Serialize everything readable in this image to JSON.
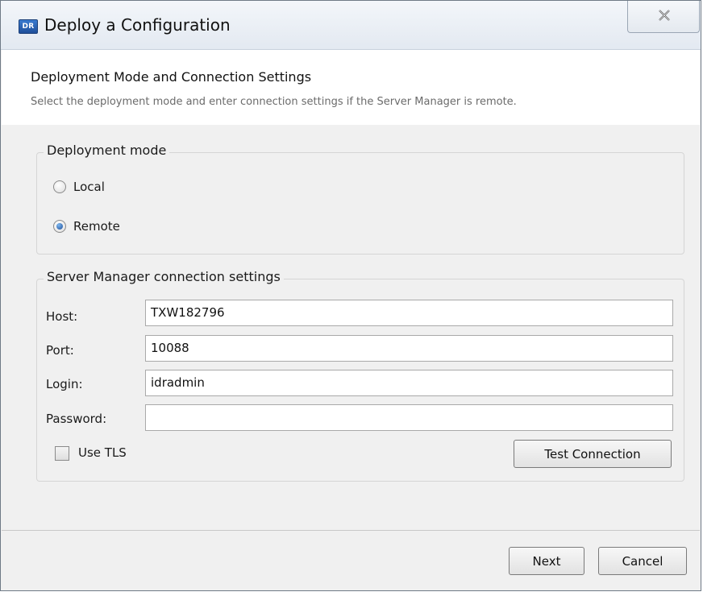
{
  "window": {
    "title": "Deploy a Configuration",
    "app_icon_text": "DR"
  },
  "header": {
    "title": "Deployment Mode and Connection Settings",
    "subtitle": "Select the deployment mode and enter connection settings if the Server Manager is remote."
  },
  "deployment_mode": {
    "legend": "Deployment mode",
    "options": [
      {
        "label": "Local",
        "checked": false
      },
      {
        "label": "Remote",
        "checked": true
      }
    ]
  },
  "connection": {
    "legend": "Server Manager connection settings",
    "host_label": "Host:",
    "host_value": "TXW182796",
    "port_label": "Port:",
    "port_value": "10088",
    "login_label": "Login:",
    "login_value": "idradmin",
    "password_label": "Password:",
    "password_value": "",
    "use_tls_label": "Use TLS",
    "use_tls_checked": false,
    "test_button": "Test Connection"
  },
  "footer": {
    "next_button": "Next",
    "cancel_button": "Cancel"
  }
}
